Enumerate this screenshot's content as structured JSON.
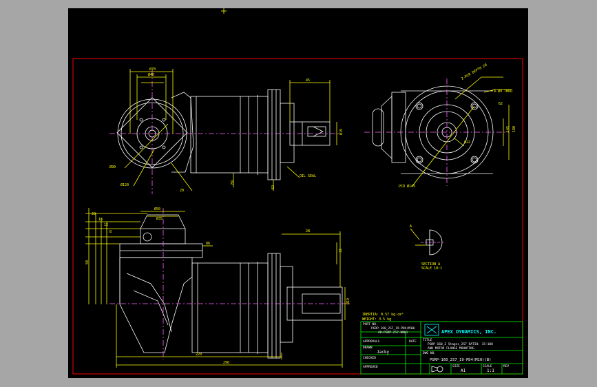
{
  "colors": {
    "background": "#a6a6a6",
    "canvas": "#000000",
    "border": "#ff0000",
    "geometry": "#ffffff",
    "dimension": "#ffff00",
    "title_block": "#00ff00",
    "logo": "#00ffff",
    "centerline": "#ff66ff"
  },
  "labels": {
    "section_label": "SECTION A",
    "section_scale": "SCALE 10:1",
    "view_marker": "A",
    "inertia": "INERTIA: 0.57 kg·cm²",
    "weight": "WEIGHT: 3.5 kg",
    "note_thread": "2-M10 DEPTH 20",
    "note_bolt": "4-Ø9 THRU",
    "note_pcd": "PCD Ø145",
    "note_seal": "OIL SEAL",
    "dims_top": [
      "Ø70",
      "Ø40",
      "Ø90",
      "Ø120",
      "89",
      "62",
      "20",
      "45",
      "Ø19"
    ],
    "dims_front": [
      "180",
      "145",
      "Ø22",
      "62"
    ],
    "dims_bottom": [
      "Ø50",
      "Ø35",
      "50",
      "20",
      "18",
      "12",
      "8",
      "86",
      "220",
      "296",
      "28",
      "32",
      "Ø19"
    ]
  },
  "title_block": {
    "part_no_label": "PART NO.",
    "part_no": "PGRP-160_2S7_19-PD4(M10)",
    "part_no_2": "AB-PGRP-2S7-HN01",
    "approved_label": "APPROVALS",
    "date_label": "DATE",
    "drawn_label": "DRAWN",
    "drawn_by": "Jacky",
    "checked_label": "CHECKED",
    "approval_label": "APPROVED",
    "company": "APEX DYNAMICS, INC.",
    "title_label": "TITLE",
    "title_line1": "PGRP-160_2 Stages_2S7 RATIO: 15~100",
    "title_line2": "AND MOTOR FLANGE MOUNTING",
    "dwg_no_label": "DWG NO.",
    "dwg_no": "PGRP-160_2S7_19-PD4(M10)(B)",
    "size_label": "SIZE",
    "size": "A1",
    "scale_label": "SCALE",
    "scale": "1:1",
    "rev_label": "REV"
  }
}
